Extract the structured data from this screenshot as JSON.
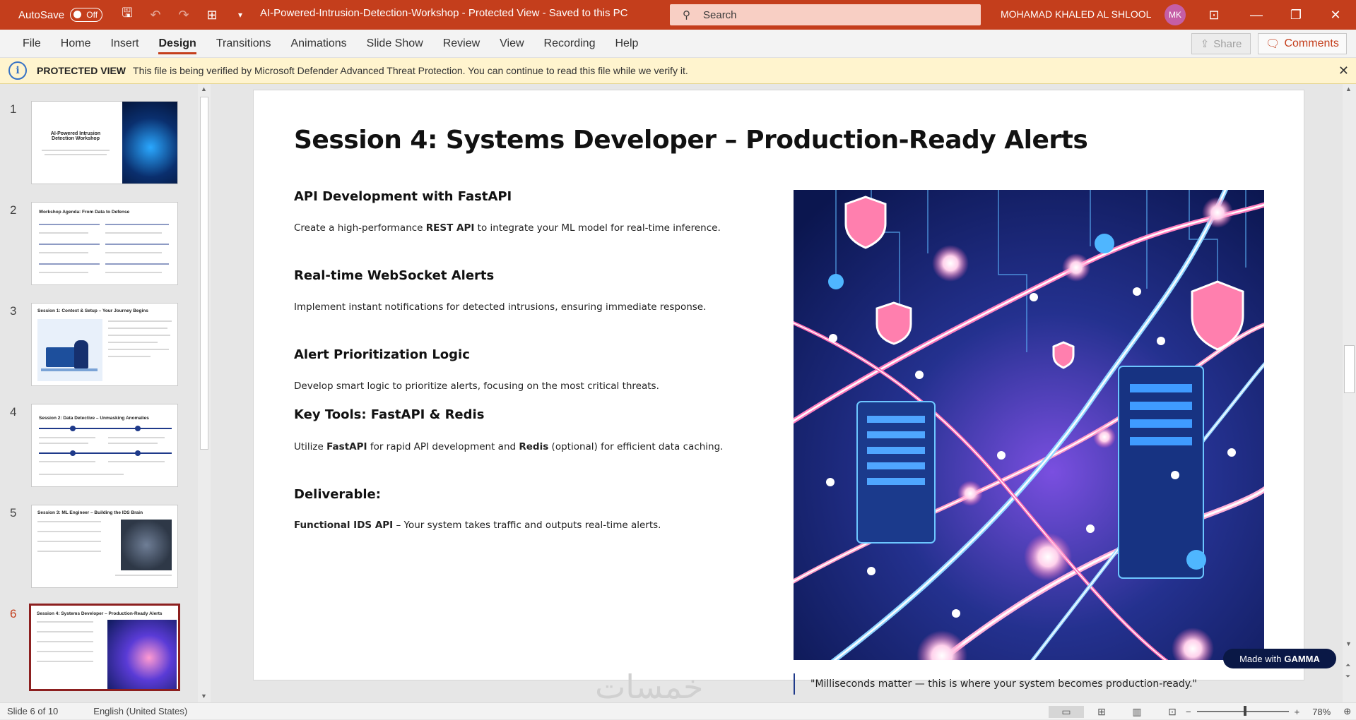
{
  "titlebar": {
    "autosave_label": "AutoSave",
    "autosave_state": "Off",
    "doc_title": "AI-Powered-Intrusion-Detection-Workshop  -  Protected View  -  Saved to this PC",
    "search_placeholder": "Search",
    "user_name": "MOHAMAD KHALED AL SHLOOL",
    "user_initials": "MK"
  },
  "ribbon": {
    "tabs": [
      "File",
      "Home",
      "Insert",
      "Design",
      "Transitions",
      "Animations",
      "Slide Show",
      "Review",
      "View",
      "Recording",
      "Help"
    ],
    "active_tab": "Design",
    "share_label": "Share",
    "comments_label": "Comments"
  },
  "protected_view": {
    "label": "PROTECTED VIEW",
    "message": "This file is being verified by Microsoft Defender Advanced Threat Protection. You can continue to read this file while we verify it."
  },
  "thumbnails": [
    {
      "num": "1",
      "title": "AI-Powered Intrusion Detection Workshop"
    },
    {
      "num": "2",
      "title": "Workshop Agenda: From Data to Defense"
    },
    {
      "num": "3",
      "title": "Session 1: Context & Setup – Your Journey Begins"
    },
    {
      "num": "4",
      "title": "Session 2: Data Detective – Unmasking Anomalies"
    },
    {
      "num": "5",
      "title": "Session 3: ML Engineer – Building the IDS Brain"
    },
    {
      "num": "6",
      "title": "Session 4: Systems Developer – Production-Ready Alerts"
    }
  ],
  "active_slide": 6,
  "slide": {
    "title": "Session 4: Systems Developer – Production-Ready Alerts",
    "sections": [
      {
        "heading": "API Development with FastAPI",
        "pre": "Create a high-performance ",
        "bold": "REST API",
        "post": " to integrate your ML model for real-time inference."
      },
      {
        "heading": "Real-time WebSocket Alerts",
        "pre": "Implement instant notifications for detected intrusions, ensuring immediate response.",
        "bold": "",
        "post": ""
      },
      {
        "heading": "Alert Prioritization Logic",
        "pre": "Develop smart logic to prioritize alerts, focusing on the most critical threats.",
        "bold": "",
        "post": ""
      },
      {
        "heading": "Key Tools: FastAPI & Redis",
        "pre": "Utilize ",
        "bold": "FastAPI",
        "post": " for rapid API development and ",
        "bold2": "Redis",
        "post2": " (optional) for efficient data caching."
      },
      {
        "heading": "Deliverable:",
        "pre": "",
        "bold": "Functional IDS API",
        "post": " – Your system takes traffic and outputs real-time alerts."
      }
    ],
    "quote": "\"Milliseconds matter — this is where your system becomes production-ready.\"",
    "badge_prefix": "Made with",
    "badge_brand": "GAMMA"
  },
  "watermark": "خمسات",
  "statusbar": {
    "slide_info": "Slide 6 of 10",
    "language": "English (United States)",
    "zoom": "78%"
  }
}
